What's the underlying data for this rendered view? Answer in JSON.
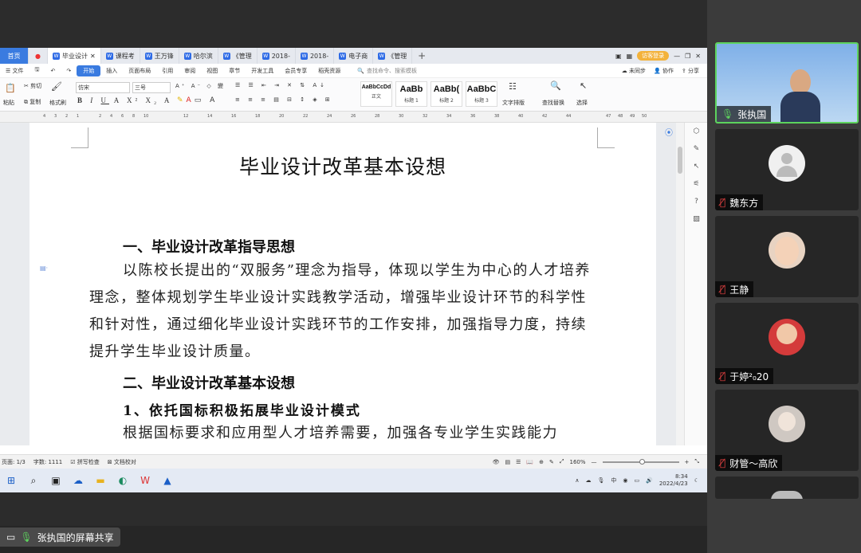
{
  "wps": {
    "tabs": {
      "home": "首页",
      "t1": "毕业设计",
      "t2": "课程考",
      "t3": "王万锋",
      "t4": "哈尔滨",
      "t5": "《管理",
      "t6": "2018-",
      "t7": "2018-",
      "t8": "电子商",
      "t9": "《管理"
    },
    "login": "访客登录",
    "menu": {
      "file": "文件",
      "start": "开始",
      "insert": "插入",
      "layout": "页面布局",
      "ref": "引用",
      "review": "审阅",
      "view": "视图",
      "chapter": "章节",
      "dev": "开发工具",
      "vip": "会员专享",
      "template": "稻壳资源",
      "search": "查找命令、搜索模板",
      "sync": "未同步",
      "collab": "协作",
      "share": "分享"
    },
    "ribbon": {
      "paste": "粘贴",
      "cut": "剪切",
      "copy": "复制",
      "format_painter": "格式刷",
      "font": "仿宋",
      "size": "三号",
      "styles": [
        {
          "sample": "AaBbCcDd",
          "name": "正文"
        },
        {
          "sample": "AaBb",
          "name": "标题 1"
        },
        {
          "sample": "AaBb(",
          "name": "标题 2"
        },
        {
          "sample": "AaBbC",
          "name": "标题 3"
        }
      ],
      "text_layout": "文字排版",
      "find_replace": "查找替换",
      "select": "选择"
    },
    "doc": {
      "title": "毕业设计改革基本设想",
      "h1_a": "一、毕业设计改革指导思想",
      "p1": "以陈校长提出的“双服务”理念为指导，体现以学生为中心的人才培养理念，整体规划学生毕业设计实践教学活动，增强毕业设计环节的科学性和针对性，通过细化毕业设计实践环节的工作安排，加强指导力度，持续提升学生毕业设计质量。",
      "h1_b": "二、毕业设计改革基本设想",
      "h2_a": "1、依托国标积极拓展毕业设计模式",
      "p2": "根据国标要求和应用型人才培养需要，加强各专业学生实践能力"
    },
    "status": {
      "page": "页面: 1/3",
      "words": "字数: 1111",
      "spell": "拼写检查",
      "proof": "文档校对",
      "zoom": "160%"
    },
    "clock": {
      "time": "8:34",
      "date": "2022/4/23"
    }
  },
  "participants": [
    {
      "name": "张执国",
      "muted": false,
      "speaking": true
    },
    {
      "name": "魏东方",
      "muted": true
    },
    {
      "name": "王静",
      "muted": true
    },
    {
      "name": "于婷²₀20",
      "muted": true
    },
    {
      "name": "财管～高欣",
      "muted": true
    }
  ],
  "share_label": "张执国的屏幕共享"
}
